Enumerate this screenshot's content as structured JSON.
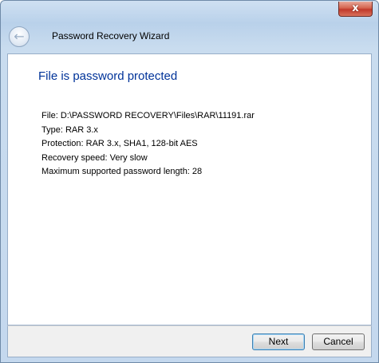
{
  "window": {
    "close_glyph": "x"
  },
  "header": {
    "back_glyph": "←",
    "title": "Password Recovery Wizard"
  },
  "main": {
    "heading": "File is password protected",
    "file_info": [
      "File: D:\\PASSWORD RECOVERY\\Files\\RAR\\11191.rar",
      "Type: RAR 3.x",
      "Protection: RAR 3.x, SHA1, 128-bit AES",
      "Recovery speed: Very slow",
      "Maximum supported password length: 28"
    ]
  },
  "footer": {
    "next_label": "Next",
    "cancel_label": "Cancel"
  },
  "colors": {
    "heading": "#003399",
    "close_button": "#c0392b",
    "frame": "#c4d8ee"
  }
}
